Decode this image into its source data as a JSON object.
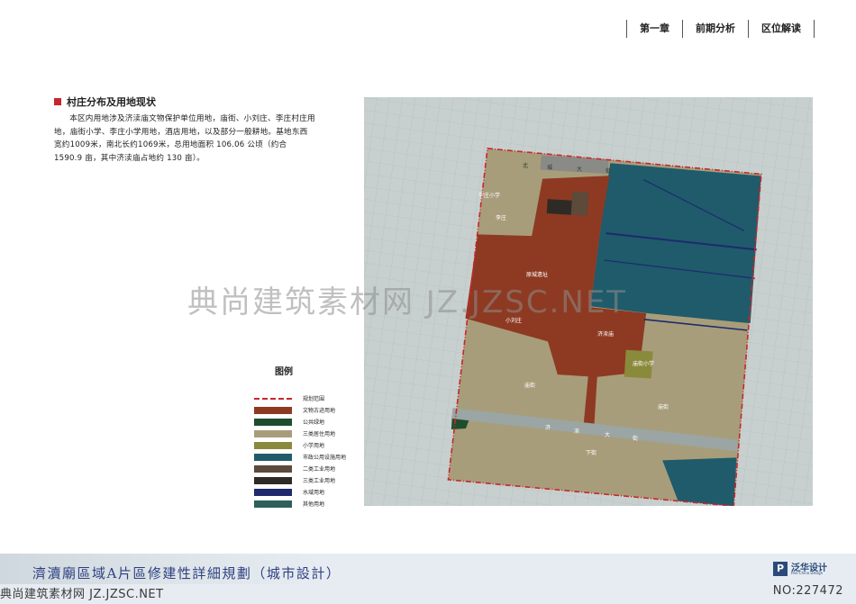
{
  "nav": {
    "items": [
      "第一章",
      "前期分析",
      "区位解读"
    ]
  },
  "section": {
    "title": "村庄分布及用地现状",
    "body": "本区内用地涉及济渎庙文物保护单位用地，庙街、小刘庄、李庄村庄用地，庙街小学、李庄小学用地，酒店用地，以及部分一般耕地。基地东西宽约1009米，南北长约1069米，总用地面积 106.06 公顷（约合 1590.9 亩，其中济渎庙占地约 130 亩）。"
  },
  "map": {
    "labels": {
      "lizhuang_school": "李庄小学",
      "lizhuang": "李庄",
      "old_city": "原城遗址",
      "xiaoliuzhuang": "小刘庄",
      "jidu_temple": "济渎庙",
      "miaojie_school": "庙街小学",
      "miaojie_w": "庙街",
      "miaojie_e": "庙街",
      "xiajie": "下街",
      "road_south": [
        "济",
        "渎",
        "大",
        "街"
      ],
      "road_north": [
        "北",
        "城",
        "大",
        "街"
      ]
    }
  },
  "legend": {
    "title": "图例",
    "items": [
      {
        "label": "规划范围",
        "type": "border",
        "color": "#c8262c"
      },
      {
        "label": "文物古迹用地",
        "type": "fill",
        "color": "#8e3a22"
      },
      {
        "label": "公共绿地",
        "type": "fill",
        "color": "#1e4d2e"
      },
      {
        "label": "三类居住用地",
        "type": "fill",
        "color": "#a89d7a"
      },
      {
        "label": "小学用地",
        "type": "fill",
        "color": "#8a8a3c"
      },
      {
        "label": "市政公用设施用地",
        "type": "fill",
        "color": "#1f5b6b"
      },
      {
        "label": "二类工业用地",
        "type": "fill",
        "color": "#5c4a3a"
      },
      {
        "label": "三类工业用地",
        "type": "fill",
        "color": "#2e2a26"
      },
      {
        "label": "水域用地",
        "type": "fill",
        "color": "#1f2a6e"
      },
      {
        "label": "其他用地",
        "type": "fill",
        "color": "#2f5f5a"
      }
    ]
  },
  "watermark": {
    "center": "典尚建筑素材网 JZ.JZSC.NET",
    "bottom": "典尚建筑素材网 JZ.JZSC.NET",
    "number": "NO:227472"
  },
  "footer": {
    "title": "濟瀆廟區域A片區修建性詳細規劃（城市設計）",
    "logo_mark": "P",
    "logo_cn": "泛华设计",
    "logo_en": "Pan-China Design"
  },
  "colors": {
    "heritage": "#8e3a22",
    "residential": "#a89d7a",
    "utility": "#1f5b6b",
    "other": "#2f5f5a",
    "boundary": "#c8262c"
  }
}
